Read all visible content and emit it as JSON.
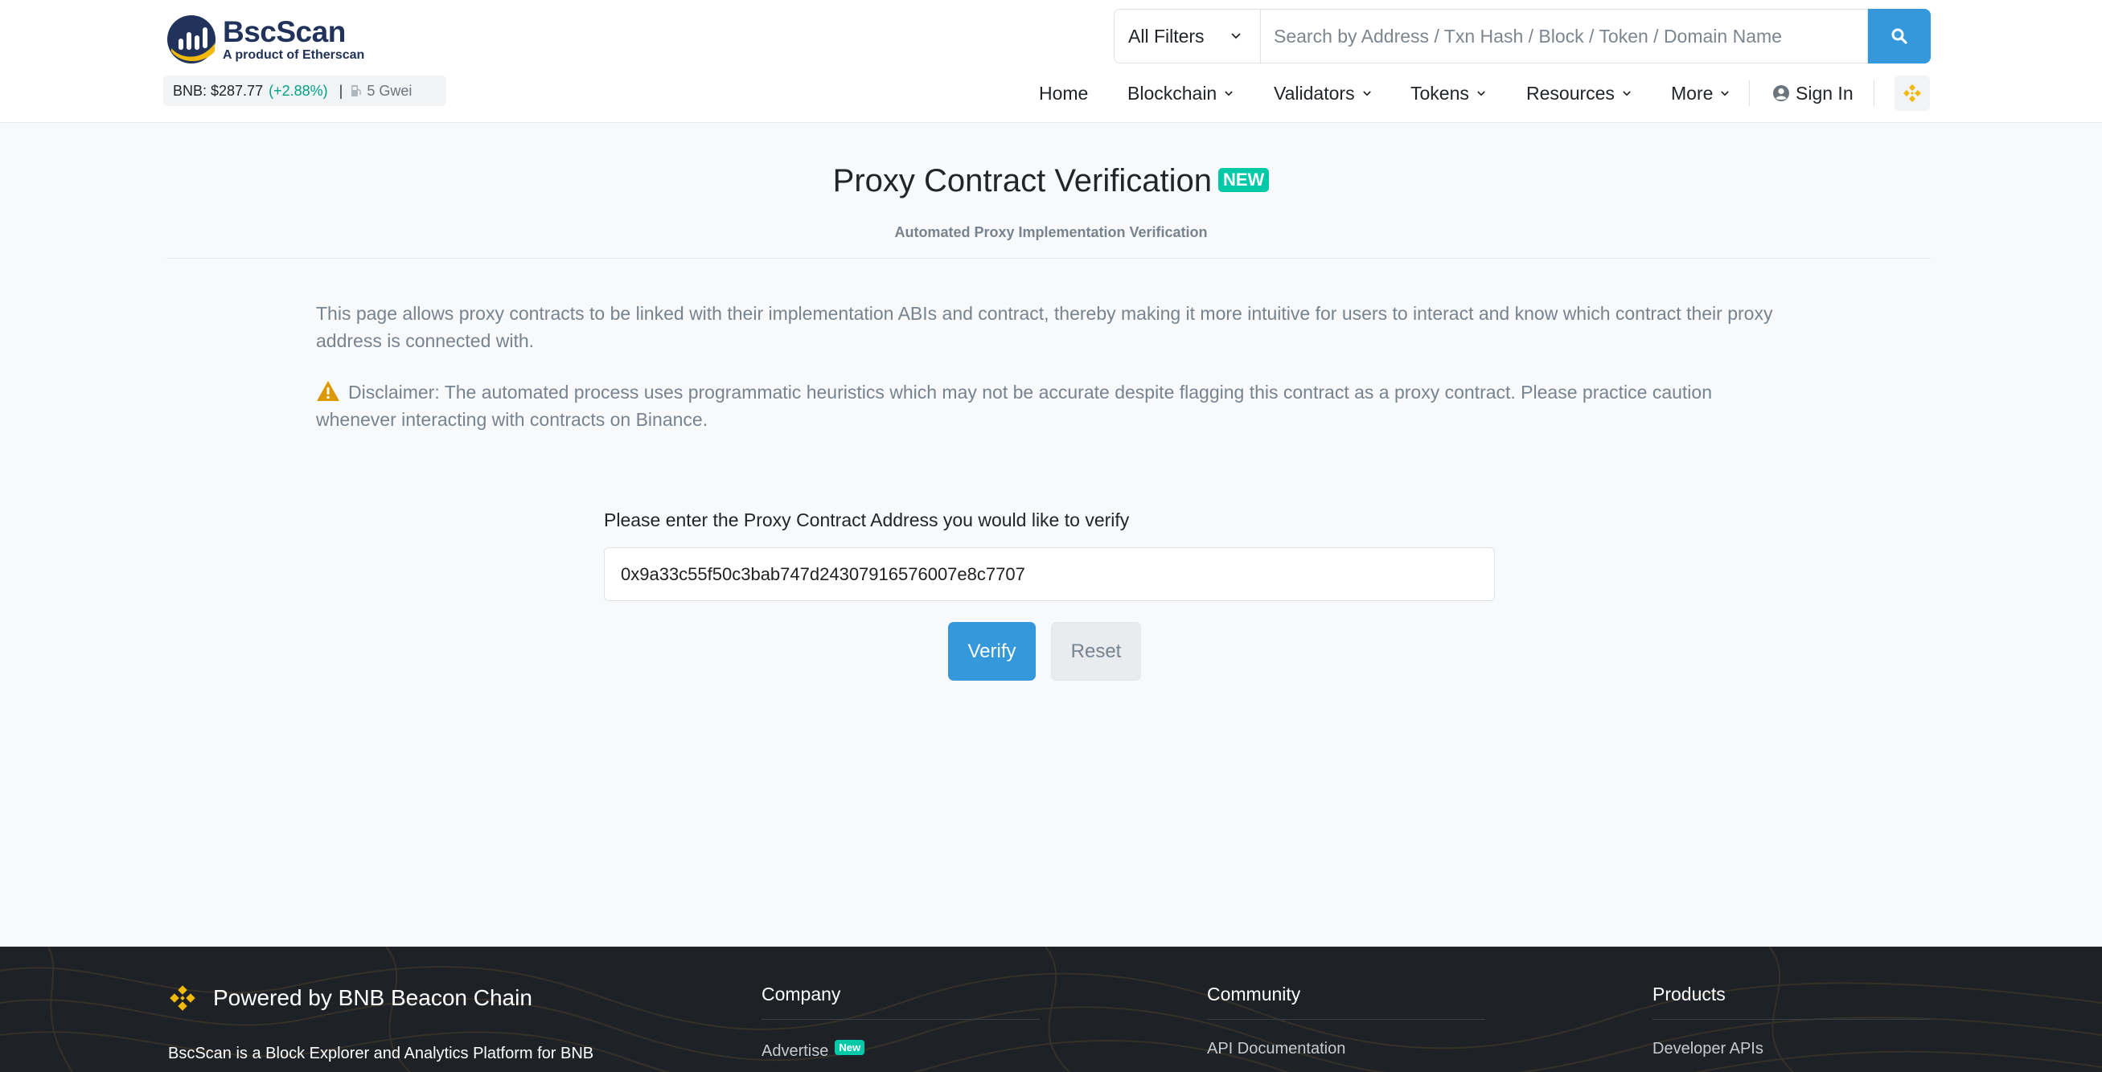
{
  "header": {
    "logo_title": "BscScan",
    "logo_subtitle": "A product of Etherscan",
    "price_label": "BNB: $287.77",
    "price_change": "(+2.88%)",
    "gas": "5 Gwei",
    "filter_label": "All Filters",
    "search_placeholder": "Search by Address / Txn Hash / Block / Token / Domain Name"
  },
  "nav": {
    "home": "Home",
    "blockchain": "Blockchain",
    "validators": "Validators",
    "tokens": "Tokens",
    "resources": "Resources",
    "more": "More",
    "sign_in": "Sign In"
  },
  "main": {
    "title": "Proxy Contract Verification",
    "badge": "NEW",
    "subtitle": "Automated Proxy Implementation Verification",
    "intro": "This page allows proxy contracts to be linked with their implementation ABIs and contract, thereby making it more intuitive for users to interact and know which contract their proxy address is connected with.",
    "disclaimer": "Disclaimer: The automated process uses programmatic heuristics which may not be accurate despite flagging this contract as a proxy contract. Please practice caution whenever interacting with contracts on Binance.",
    "form_label": "Please enter the Proxy Contract Address you would like to verify",
    "address_value": "0x9a33c55f50c3bab747d24307916576007e8c7707",
    "verify_label": "Verify",
    "reset_label": "Reset"
  },
  "footer": {
    "brand": "Powered by BNB Beacon Chain",
    "description": "BscScan is a Block Explorer and Analytics Platform for BNB",
    "columns": [
      {
        "title": "Company",
        "link": "Advertise",
        "badge": "New"
      },
      {
        "title": "Community",
        "link": "API Documentation"
      },
      {
        "title": "Products",
        "link": "Developer APIs"
      }
    ]
  },
  "colors": {
    "primary": "#3498db",
    "success": "#00c9a7",
    "bnb_yellow": "#f0b90b",
    "footer_bg": "#1e2126"
  },
  "icons": [
    "bscscan-logo-icon",
    "gas-pump-icon",
    "chevron-down-icon",
    "search-icon",
    "user-circle-icon",
    "bnb-icon",
    "warning-icon"
  ]
}
